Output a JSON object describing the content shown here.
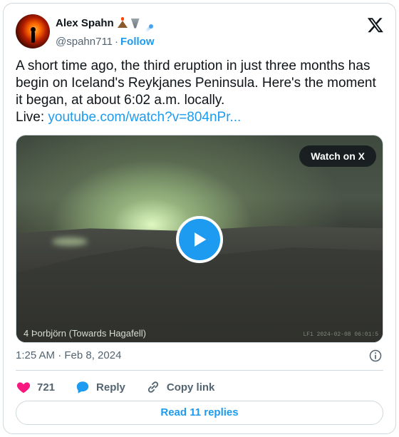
{
  "author": {
    "name": "Alex Spahn",
    "emoji": [
      "volcano-emoji",
      "tornado-emoji",
      "comet-emoji"
    ],
    "handle": "@spahn711",
    "separator": "·",
    "follow_label": "Follow"
  },
  "tweet": {
    "text": "A short time ago, the third eruption in just three months has begin on Iceland's Reykjanes Peninsula. Here's the moment it began, at about 6:02 a.m. locally.",
    "live_prefix": "Live: ",
    "link_text": "youtube.com/watch?v=804nPr..."
  },
  "media": {
    "watch_label": "Watch on X",
    "caption": "4 Þorbjörn (Towards Hagafell)",
    "stamp": "LF1 2024-02-08 06:01:5"
  },
  "meta": {
    "timestamp": "1:25 AM · Feb 8, 2024"
  },
  "actions": {
    "likes": "721",
    "reply_label": "Reply",
    "copy_label": "Copy link"
  },
  "replies_button": "Read 11 replies",
  "colors": {
    "accent": "#1d9bf0",
    "like": "#f91880",
    "muted": "#536471",
    "border": "#cfd9de"
  }
}
